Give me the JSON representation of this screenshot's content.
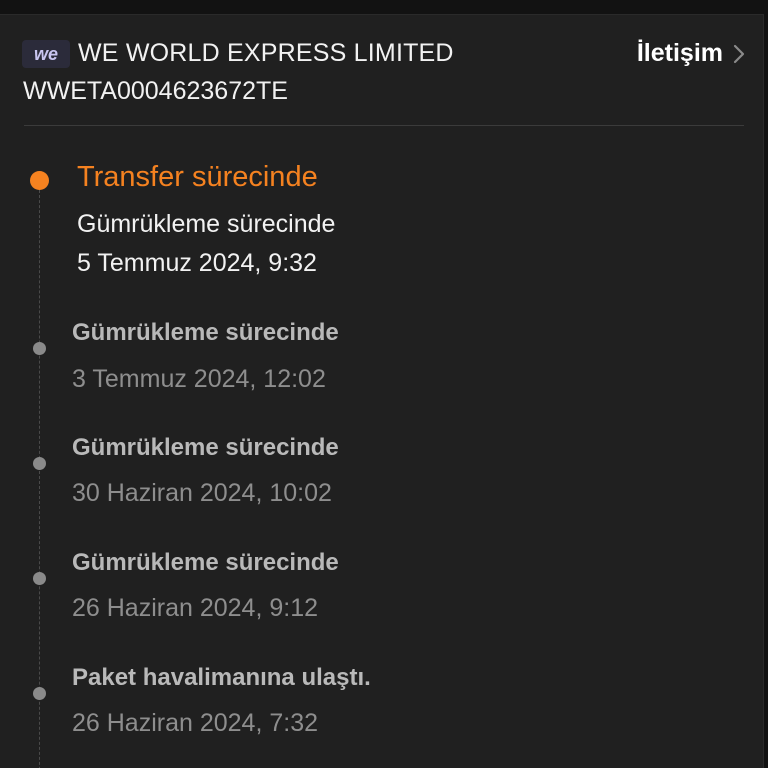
{
  "carrier": {
    "logo_text": "we",
    "name": "WE WORLD EXPRESS LIMITED",
    "tracking_number": "WWETA0004623672TE"
  },
  "contact": {
    "label": "İletişim",
    "icon": "chevron-right-icon"
  },
  "colors": {
    "accent": "#f58220",
    "background": "#202020",
    "logo_bg": "#2b2b3a",
    "logo_text": "#c9c5f0"
  },
  "current": {
    "status": "Transfer sürecinde",
    "detail": "Gümrükleme sürecinde",
    "datetime": "5 Temmuz 2024, 9:32"
  },
  "events": [
    {
      "status": "Gümrükleme sürecinde",
      "datetime": "3 Temmuz 2024, 12:02"
    },
    {
      "status": "Gümrükleme sürecinde",
      "datetime": "30 Haziran 2024, 10:02"
    },
    {
      "status": "Gümrükleme sürecinde",
      "datetime": "26 Haziran 2024, 9:12"
    },
    {
      "status": "Paket havalimanına ulaştı.",
      "datetime": "26 Haziran 2024, 7:32"
    }
  ]
}
